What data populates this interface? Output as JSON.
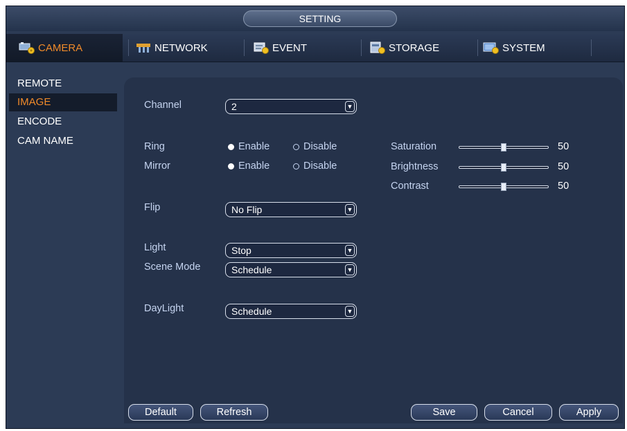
{
  "window": {
    "title": "SETTING"
  },
  "tabs": [
    {
      "label": "CAMERA",
      "icon": "camera-icon",
      "active": true
    },
    {
      "label": "NETWORK",
      "icon": "network-icon",
      "active": false
    },
    {
      "label": "EVENT",
      "icon": "event-icon",
      "active": false
    },
    {
      "label": "STORAGE",
      "icon": "storage-icon",
      "active": false
    },
    {
      "label": "SYSTEM",
      "icon": "system-icon",
      "active": false
    }
  ],
  "sidebar": {
    "items": [
      {
        "label": "REMOTE",
        "active": false
      },
      {
        "label": "IMAGE",
        "active": true
      },
      {
        "label": "ENCODE",
        "active": false
      },
      {
        "label": "CAM NAME",
        "active": false
      }
    ]
  },
  "form": {
    "channel": {
      "label": "Channel",
      "value": "2"
    },
    "ring": {
      "label": "Ring",
      "enable_label": "Enable",
      "disable_label": "Disable",
      "selected": "Enable"
    },
    "mirror": {
      "label": "Mirror",
      "enable_label": "Enable",
      "disable_label": "Disable",
      "selected": "Enable"
    },
    "flip": {
      "label": "Flip",
      "value": "No Flip"
    },
    "light": {
      "label": "Light",
      "value": "Stop"
    },
    "scene_mode": {
      "label": "Scene Mode",
      "value": "Schedule"
    },
    "daylight": {
      "label": "DayLight",
      "value": "Schedule"
    }
  },
  "sliders": [
    {
      "label": "Saturation",
      "value": "50",
      "fraction": 0.5
    },
    {
      "label": "Brightness",
      "value": "50",
      "fraction": 0.5
    },
    {
      "label": "Contrast",
      "value": "50",
      "fraction": 0.5
    }
  ],
  "buttons": {
    "default": "Default",
    "refresh": "Refresh",
    "save": "Save",
    "cancel": "Cancel",
    "apply": "Apply"
  },
  "colors": {
    "accent": "#f08a2a",
    "panel": "#25324a",
    "background": "#2c3b55"
  }
}
